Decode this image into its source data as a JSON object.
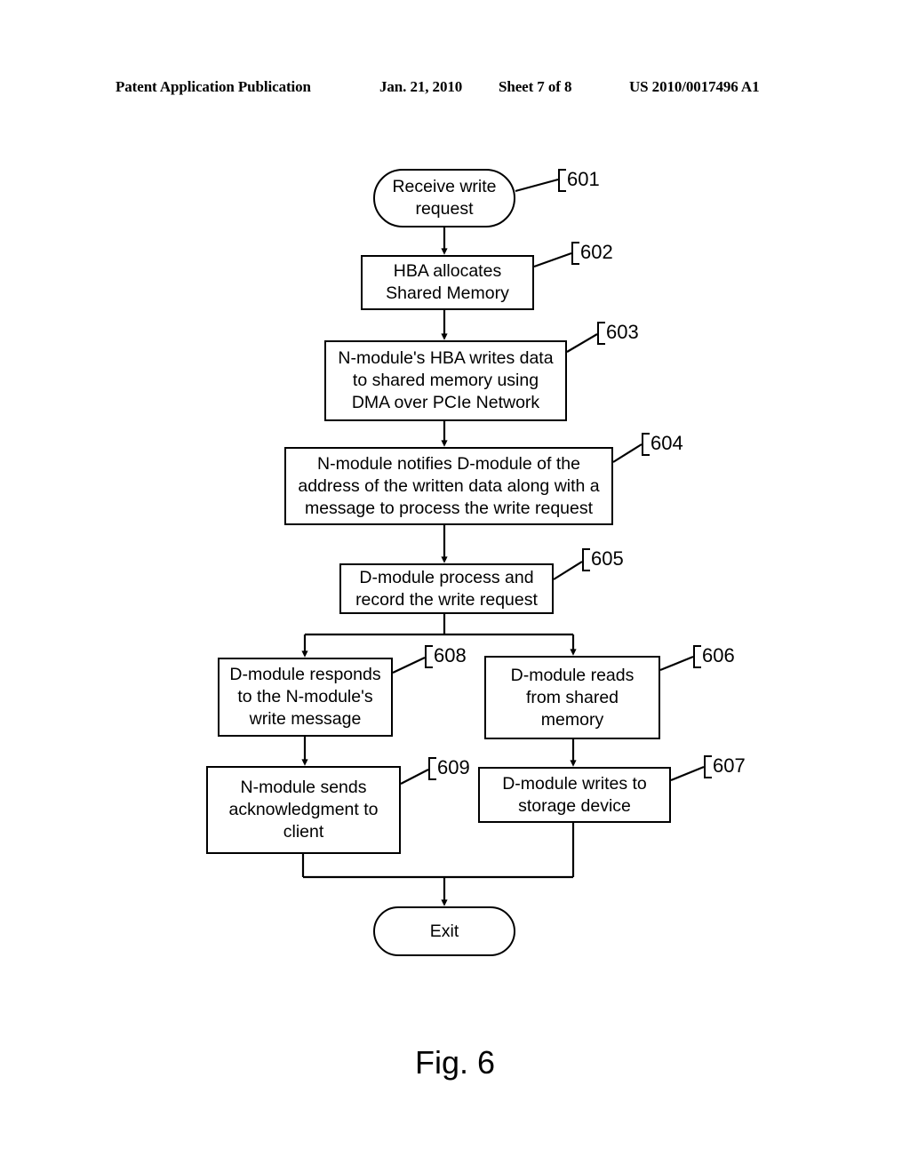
{
  "header": {
    "publication": "Patent Application Publication",
    "date": "Jan. 21, 2010",
    "sheet": "Sheet 7 of 8",
    "patent_number": "US 2010/0017496 A1"
  },
  "figure": {
    "caption": "Fig. 6",
    "nodes": [
      {
        "ref": "601",
        "shape": "terminal",
        "text": "Receive write\nrequest"
      },
      {
        "ref": "602",
        "shape": "process",
        "text": "HBA allocates\nShared Memory"
      },
      {
        "ref": "603",
        "shape": "process",
        "text": "N-module's HBA writes data\nto shared memory using\nDMA over PCIe Network"
      },
      {
        "ref": "604",
        "shape": "process",
        "text": "N-module notifies D-module of the\naddress of the written data along with a\nmessage to process the write request"
      },
      {
        "ref": "605",
        "shape": "process",
        "text": "D-module process  and\nrecord the write request"
      },
      {
        "ref": "608",
        "shape": "process",
        "text": "D-module responds\nto the N-module's\nwrite message"
      },
      {
        "ref": "606",
        "shape": "process",
        "text": "D-module reads\nfrom shared\nmemory"
      },
      {
        "ref": "609",
        "shape": "process",
        "text": "N-module sends\nacknowledgment to\nclient"
      },
      {
        "ref": "607",
        "shape": "process",
        "text": "D-module writes to\nstorage device"
      },
      {
        "ref": "exit",
        "shape": "terminal",
        "text": "Exit"
      }
    ],
    "refnums": {
      "r601": "601",
      "r602": "602",
      "r603": "603",
      "r604": "604",
      "r605": "605",
      "r606": "606",
      "r607": "607",
      "r608": "608",
      "r609": "609"
    },
    "node_text": {
      "n601": "Receive write\nrequest",
      "n602": "HBA allocates\nShared Memory",
      "n603": "N-module's HBA writes data\nto shared memory using\nDMA over PCIe Network",
      "n604": "N-module notifies D-module of the\naddress of the written data along with a\nmessage to process the write request",
      "n605": "D-module process  and\nrecord the write request",
      "n608": "D-module responds\nto the N-module's\nwrite message",
      "n606": "D-module reads\nfrom shared\nmemory",
      "n609": "N-module sends\nacknowledgment to\nclient",
      "n607": "D-module writes to\nstorage device",
      "nexit": "Exit"
    }
  },
  "colors": {
    "ink": "#000000",
    "paper": "#ffffff"
  }
}
